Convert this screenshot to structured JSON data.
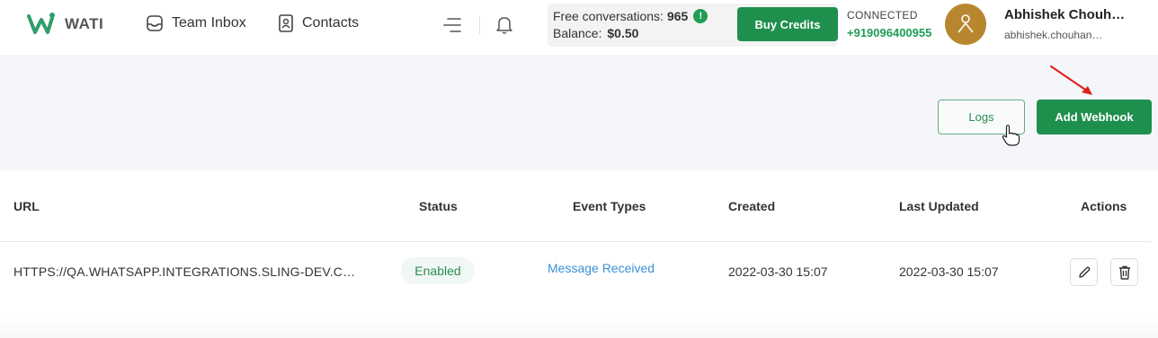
{
  "header": {
    "brand": "WATI",
    "nav": {
      "team_inbox": "Team Inbox",
      "contacts": "Contacts"
    },
    "credits": {
      "free_label": "Free conversations:",
      "free_count": "965",
      "info": "!",
      "balance_label": "Balance:",
      "balance_value": "$0.50"
    },
    "buy_label": "Buy Credits",
    "connection": {
      "status": "CONNECTED",
      "phone": "+919096400955"
    },
    "user": {
      "name": "Abhishek Chouh…",
      "email": "abhishek.chouhan…"
    }
  },
  "actions": {
    "logs_label": "Logs",
    "add_label": "Add Webhook"
  },
  "table": {
    "columns": [
      "URL",
      "Status",
      "Event Types",
      "Created",
      "Last Updated",
      "Actions"
    ],
    "rows": [
      {
        "url": "HTTPS://QA.WHATSAPP.INTEGRATIONS.SLING-DEV.COM/A...",
        "status": "Enabled",
        "event_types": "Message Received",
        "created": "2022-03-30 15:07",
        "last_updated": "2022-03-30 15:07"
      }
    ]
  },
  "colors": {
    "primary_green": "#1f8f4e",
    "link_blue": "#3b8fd9",
    "annotation_red": "#e02020",
    "avatar_gold": "#b8862e"
  },
  "icons": [
    "wati-logo-icon",
    "inbox-icon",
    "contacts-icon",
    "menu-icon",
    "bell-icon",
    "info-icon",
    "user-avatar-icon",
    "pointer-cursor-icon",
    "annotation-arrow-icon",
    "edit-icon",
    "delete-icon"
  ]
}
